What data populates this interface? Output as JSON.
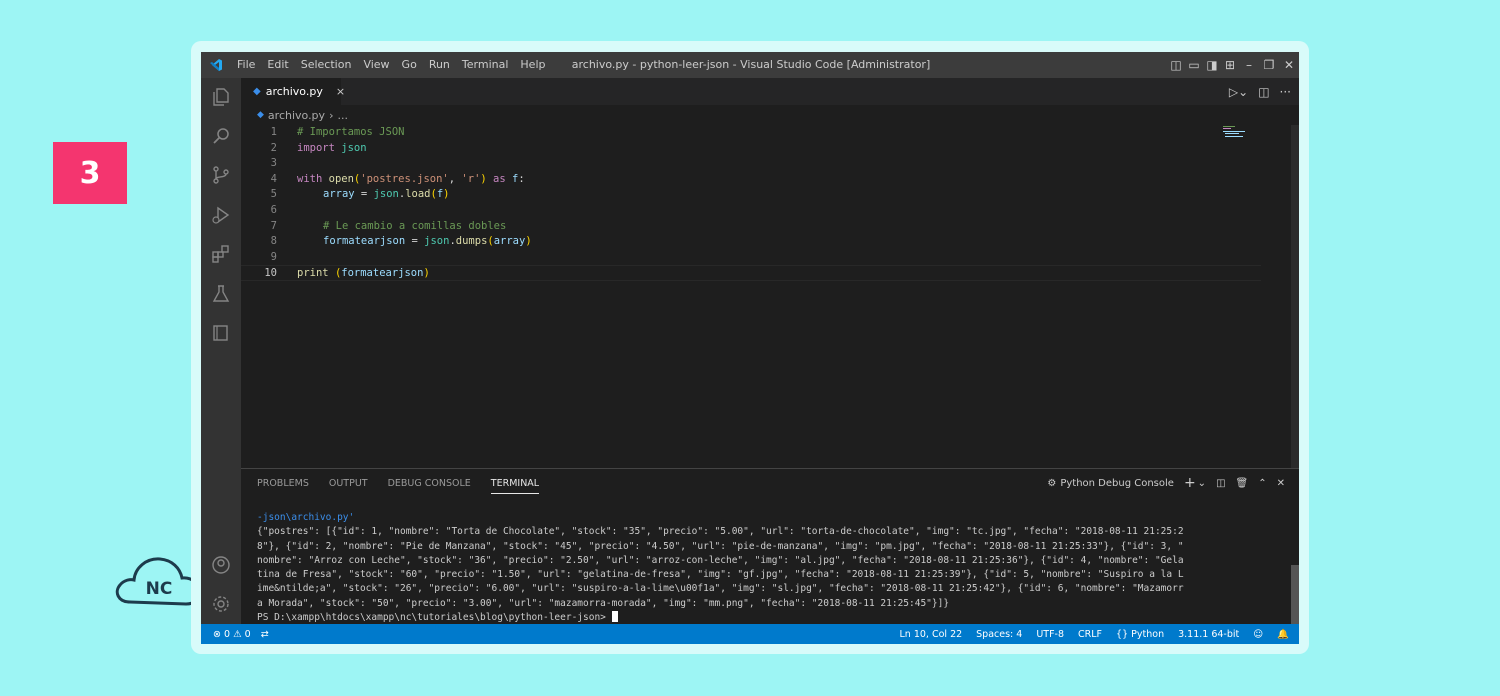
{
  "badge": {
    "number": "3"
  },
  "logo": {
    "text": "NC"
  },
  "titlebar": {
    "menu": [
      "File",
      "Edit",
      "Selection",
      "View",
      "Go",
      "Run",
      "Terminal",
      "Help"
    ],
    "title": "archivo.py - python-leer-json - Visual Studio Code [Administrator]"
  },
  "tab": {
    "label": "archivo.py",
    "close": "×"
  },
  "breadcrumb": {
    "file": "archivo.py",
    "sep": "›",
    "more": "..."
  },
  "code": {
    "line_numbers": [
      "1",
      "2",
      "3",
      "4",
      "5",
      "6",
      "7",
      "8",
      "9",
      "10"
    ],
    "l1": "# Importamos JSON",
    "l2_kw": "import",
    "l2_mod": "json",
    "l4_with": "with",
    "l4_open": "open",
    "l4_p1": "(",
    "l4_s1": "'postres.json'",
    "l4_comma": ", ",
    "l4_s2": "'r'",
    "l4_p2": ")",
    "l4_as": "as",
    "l4_f": "f",
    "l4_colon": ":",
    "l5_var": "array",
    "l5_eq": " = ",
    "l5_mod": "json",
    "l5_dot": ".",
    "l5_fn": "load",
    "l5_p1": "(",
    "l5_arg": "f",
    "l5_p2": ")",
    "l7": "# Le cambio a comillas dobles",
    "l8_var": "formatearjson",
    "l8_eq": " = ",
    "l8_mod": "json",
    "l8_dot": ".",
    "l8_fn": "dumps",
    "l8_p1": "(",
    "l8_arg": "array",
    "l8_p2": ")",
    "l10_fn": "print",
    "l10_p1": "(",
    "l10_arg": "formatearjson",
    "l10_p2": ")"
  },
  "panel": {
    "tabs": [
      "PROBLEMS",
      "OUTPUT",
      "DEBUG CONSOLE",
      "TERMINAL"
    ],
    "console_label": "Python Debug Console"
  },
  "terminal": {
    "lines": [
      "-json\\archivo.py'",
      "{\"postres\": [{\"id\": 1, \"nombre\": \"Torta de Chocolate\", \"stock\": \"35\", \"precio\": \"5.00\", \"url\": \"torta-de-chocolate\", \"img\": \"tc.jpg\", \"fecha\": \"2018-08-11 21:25:2",
      "8\"}, {\"id\": 2, \"nombre\": \"Pie de Manzana\", \"stock\": \"45\", \"precio\": \"4.50\", \"url\": \"pie-de-manzana\", \"img\": \"pm.jpg\", \"fecha\": \"2018-08-11 21:25:33\"}, {\"id\": 3, \"",
      "nombre\": \"Arroz con Leche\", \"stock\": \"36\", \"precio\": \"2.50\", \"url\": \"arroz-con-leche\", \"img\": \"al.jpg\", \"fecha\": \"2018-08-11 21:25:36\"}, {\"id\": 4, \"nombre\": \"Gela",
      "tina de Fresa\", \"stock\": \"60\", \"precio\": \"1.50\", \"url\": \"gelatina-de-fresa\", \"img\": \"gf.jpg\", \"fecha\": \"2018-08-11 21:25:39\"}, {\"id\": 5, \"nombre\": \"Suspiro a la L",
      "ime&ntilde;a\", \"stock\": \"26\", \"precio\": \"6.00\", \"url\": \"suspiro-a-la-lime\\u00f1a\", \"img\": \"sl.jpg\", \"fecha\": \"2018-08-11 21:25:42\"}, {\"id\": 6, \"nombre\": \"Mazamorr",
      "a Morada\", \"stock\": \"50\", \"precio\": \"3.00\", \"url\": \"mazamorra-morada\", \"img\": \"mm.png\", \"fecha\": \"2018-08-11 21:25:45\"}]}"
    ],
    "prompt": "PS D:\\xampp\\htdocs\\xampp\\nc\\tutoriales\\blog\\python-leer-json>"
  },
  "status": {
    "errors": "0",
    "warnings": "0",
    "position": "Ln 10, Col 22",
    "spaces": "Spaces: 4",
    "encoding": "UTF-8",
    "eol": "CRLF",
    "language": "Python",
    "interpreter": "3.11.1 64-bit"
  },
  "colors": {
    "accent": "#007acc",
    "badge": "#f4356f",
    "background": "#9df5f4"
  }
}
